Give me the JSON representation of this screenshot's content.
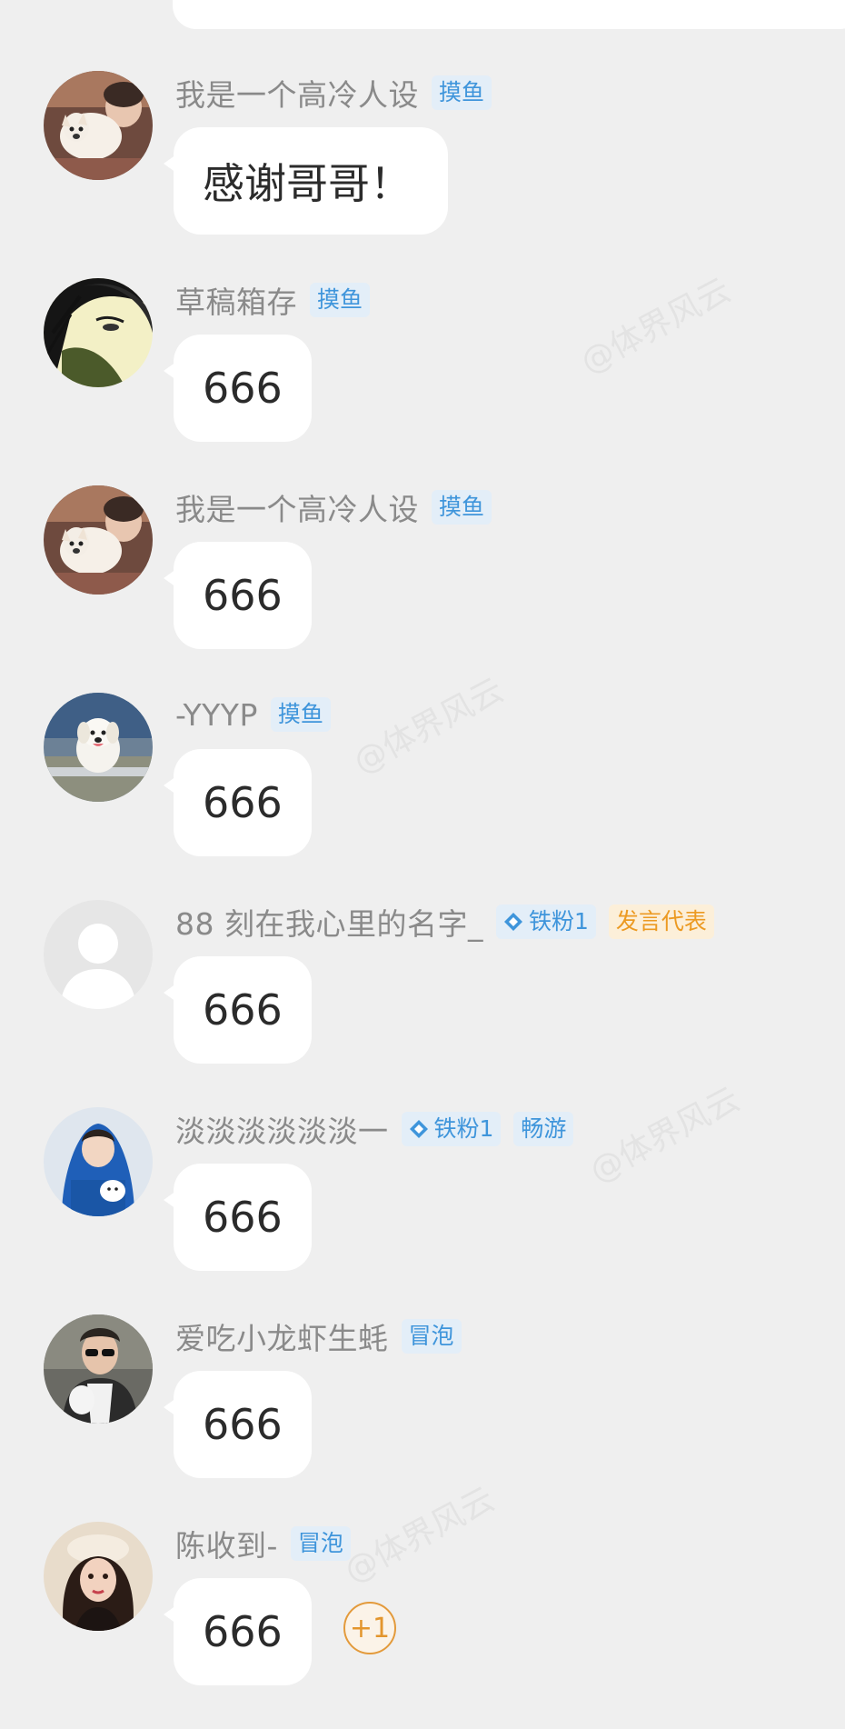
{
  "watermark": "@体界风云",
  "messages": [
    {
      "user": "我是一个高冷人设",
      "badges": [
        {
          "label": "摸鱼",
          "style": "blue"
        }
      ],
      "text": "感谢哥哥！"
    },
    {
      "user": "草稿箱存",
      "badges": [
        {
          "label": "摸鱼",
          "style": "blue"
        }
      ],
      "text": "666"
    },
    {
      "user": "我是一个高冷人设",
      "badges": [
        {
          "label": "摸鱼",
          "style": "blue"
        }
      ],
      "text": "666"
    },
    {
      "user": "-YYYP",
      "badges": [
        {
          "label": "摸鱼",
          "style": "blue"
        }
      ],
      "text": "666"
    },
    {
      "user": "88 刻在我心里的名字_",
      "badges": [
        {
          "label": "铁粉1",
          "style": "blue",
          "icon": "diamond-icon"
        },
        {
          "label": "发言代表",
          "style": "orange"
        }
      ],
      "text": "666"
    },
    {
      "user": "淡淡淡淡淡淡一",
      "badges": [
        {
          "label": "铁粉1",
          "style": "blue",
          "icon": "diamond-icon"
        },
        {
          "label": "畅游",
          "style": "blue"
        }
      ],
      "text": "666"
    },
    {
      "user": "爱吃小龙虾生蚝",
      "badges": [
        {
          "label": "冒泡",
          "style": "blue"
        }
      ],
      "text": "666"
    },
    {
      "user": "陈收到-",
      "badges": [
        {
          "label": "冒泡",
          "style": "blue"
        }
      ],
      "text": "666"
    }
  ],
  "plus_one": "+1",
  "colors": {
    "background": "#efefef",
    "bubble": "#ffffff",
    "username": "#8a8a8a",
    "badge_blue_bg": "#e3eef8",
    "badge_blue_text": "#3f95db",
    "badge_orange_bg": "#fcefd9",
    "badge_orange_text": "#ec9a22"
  }
}
